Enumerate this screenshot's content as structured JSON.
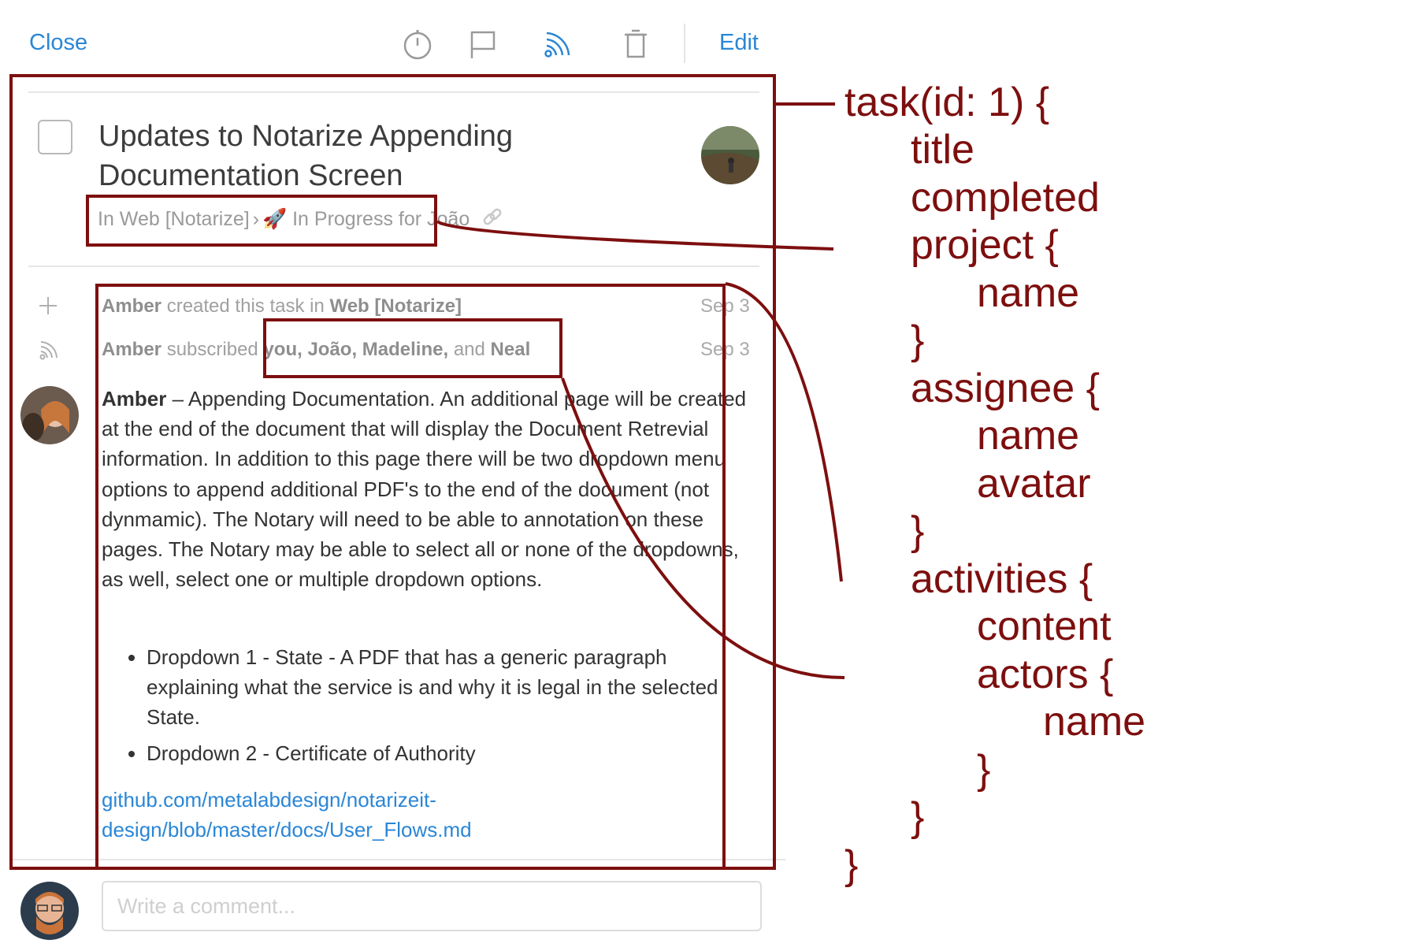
{
  "toolbar": {
    "close_label": "Close",
    "edit_label": "Edit",
    "icons": [
      "timer-icon",
      "flag-icon",
      "subscribe-icon",
      "trash-icon"
    ]
  },
  "task": {
    "title": "Updates to Notarize Appending Documentation Screen",
    "project_prefix": "In Web [Notarize]",
    "separator": "›",
    "status_emoji": "🚀",
    "status": "In Progress",
    "assignee_text": "for João"
  },
  "activity": {
    "created": {
      "actor": "Amber",
      "text": "created this task in",
      "project": "Web [Notarize]",
      "date": "Sep 3"
    },
    "subscribed": {
      "actor": "Amber",
      "text": "subscribed",
      "names": "you, João, Madeline,",
      "and": "and",
      "last_name": "Neal",
      "date": "Sep 3"
    },
    "comment": {
      "author": "Amber",
      "dash": "–",
      "body": "Appending Documentation. An additional page will be created at the end of the document that will display the Document Retrevial information. In addition to this page there will be two dropdown menu options to append additional PDF's to the end of the document (not dynmamic). The Notary will need to be able to annotation on these pages. The Notary may be able to select all or none of the dropdowns, as well, select one or multiple dropdown options.",
      "bullets": [
        "Dropdown 1 - State - A PDF that has a generic paragraph explaining what the service is and why it is legal in the selected State.",
        "Dropdown 2 - Certificate of Authority"
      ],
      "link": "github.com/metalabdesign/notarizeit-design/blob/master/docs/User_Flows.md"
    }
  },
  "comment_input": {
    "placeholder": "Write a comment..."
  },
  "annotation": {
    "lines": [
      "task(id: 1) {",
      "title",
      "completed",
      "project {",
      "name",
      "}",
      "assignee {",
      "name",
      "avatar",
      "}",
      "activities {",
      "content",
      "actors {",
      "name",
      "}",
      "}",
      "}"
    ],
    "color": "#7d0f0f"
  },
  "colors": {
    "accent": "#2a86d6",
    "annotation": "#7d0f0f"
  }
}
